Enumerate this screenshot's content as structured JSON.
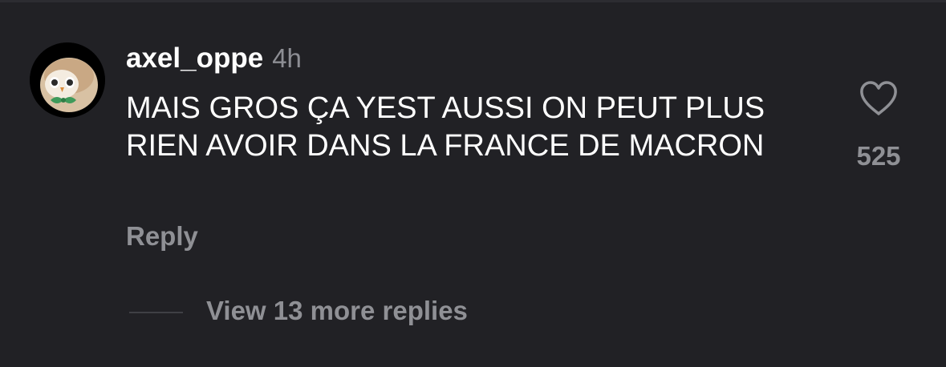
{
  "comment": {
    "avatar_icon": "rowlet-owl-avatar-icon",
    "username": "axel_oppe",
    "time_ago": "4h",
    "text": "MAIS GROS ÇA YEST AUSSI ON PEUT PLUS RIEN AVOIR DANS LA FRANCE DE MACRON",
    "reply_label": "Reply",
    "like_icon": "heart-outline-icon",
    "like_count": "525",
    "view_replies_label": "View 13 more replies"
  },
  "colors": {
    "background": "#212125",
    "text_primary": "#ffffff",
    "text_secondary": "#8f9095"
  }
}
